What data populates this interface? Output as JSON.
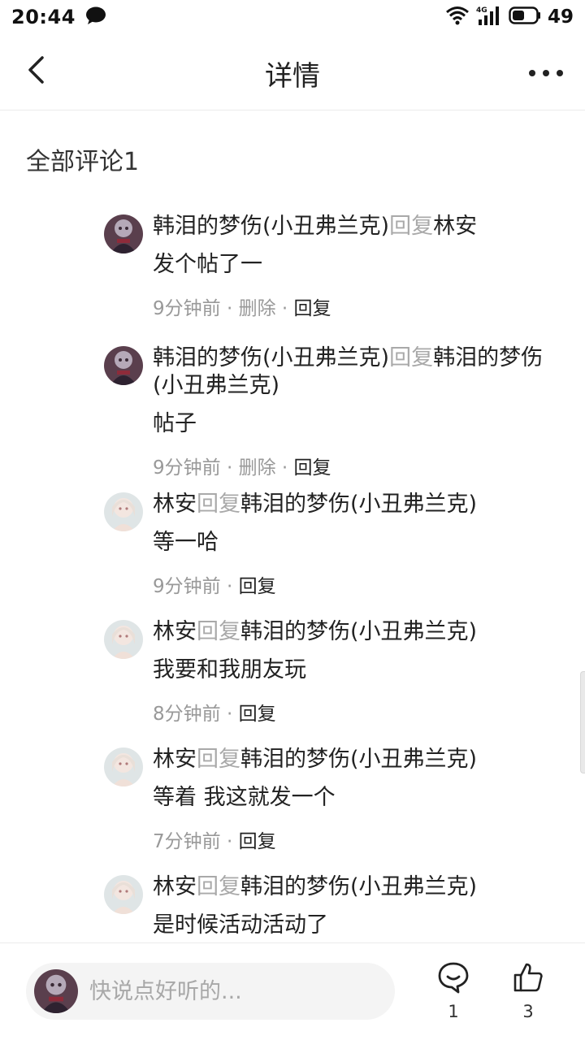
{
  "status_bar": {
    "time": "20:44",
    "battery": "49",
    "icons": [
      "chat-bubble-icon",
      "wifi-icon",
      "signal-4g-icon",
      "battery-icon"
    ]
  },
  "nav": {
    "title": "详情",
    "back_icon": "chevron-left-icon",
    "more_icon": "more-dots-icon"
  },
  "section": {
    "title": "全部评论1"
  },
  "reply_word": "回复",
  "meta_separator": " · ",
  "comments": [
    {
      "author": "韩泪的梦伤(小丑弗兰克)",
      "target": "林安",
      "body": "发个帖了一",
      "time": "9分钟前",
      "delete_label": "删除",
      "reply_label": "回复",
      "avatar": "dark"
    },
    {
      "author": "韩泪的梦伤(小丑弗兰克)",
      "target": "韩泪的梦伤(小丑弗兰克)",
      "body": "帖子",
      "time": "9分钟前",
      "delete_label": "删除",
      "reply_label": "回复",
      "avatar": "dark"
    },
    {
      "author": "林安",
      "target": "韩泪的梦伤(小丑弗兰克)",
      "body": "等一哈",
      "time": "9分钟前",
      "reply_label": "回复",
      "avatar": "light"
    },
    {
      "author": "林安",
      "target": "韩泪的梦伤(小丑弗兰克)",
      "body": "我要和我朋友玩",
      "time": "8分钟前",
      "reply_label": "回复",
      "avatar": "light"
    },
    {
      "author": "林安",
      "target": "韩泪的梦伤(小丑弗兰克)",
      "body": "等着 我这就发一个",
      "time": "7分钟前",
      "reply_label": "回复",
      "avatar": "light"
    },
    {
      "author": "林安",
      "target": "韩泪的梦伤(小丑弗兰克)",
      "body": "是时候活动活动了",
      "avatar": "light"
    }
  ],
  "bottom_bar": {
    "input_placeholder": "快说点好听的...",
    "comment_count": "1",
    "like_count": "3"
  }
}
